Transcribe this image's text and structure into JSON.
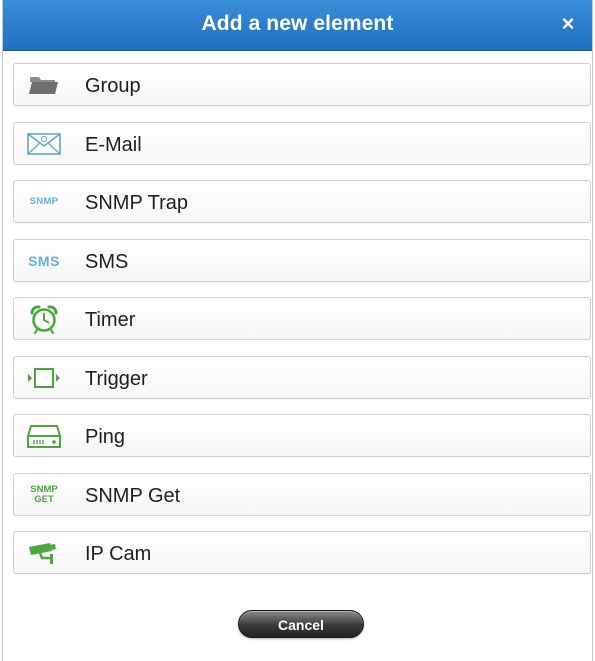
{
  "dialog": {
    "title": "Add a new element",
    "close_label": "×",
    "cancel_label": "Cancel"
  },
  "items": [
    {
      "label": "Group",
      "icon": "folder-icon"
    },
    {
      "label": "E-Mail",
      "icon": "envelope-icon"
    },
    {
      "label": "SNMP Trap",
      "icon": "snmp-trap-icon",
      "icon_text": "SNMP"
    },
    {
      "label": "SMS",
      "icon": "sms-icon",
      "icon_text": "SMS"
    },
    {
      "label": "Timer",
      "icon": "alarm-clock-icon"
    },
    {
      "label": "Trigger",
      "icon": "trigger-icon"
    },
    {
      "label": "Ping",
      "icon": "server-icon"
    },
    {
      "label": "SNMP Get",
      "icon": "snmp-get-icon",
      "icon_text_line1": "SNMP",
      "icon_text_line2": "GET"
    },
    {
      "label": "IP Cam",
      "icon": "security-camera-icon"
    }
  ],
  "colors": {
    "title_bar": "#2a7fcf",
    "email_blue": "#5aa9dd",
    "green": "#4aa83a",
    "folder_gray": "#6e6e6e",
    "button_dark": "#333333"
  }
}
